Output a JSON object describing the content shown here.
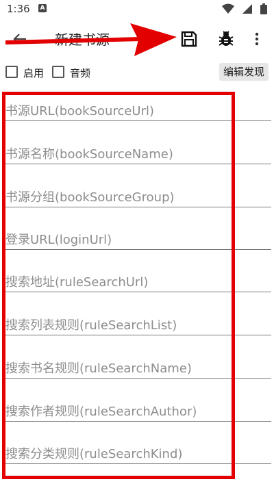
{
  "status_bar": {
    "time": "1:36",
    "notif_letter": "A"
  },
  "toolbar": {
    "title": "新建书源"
  },
  "options": {
    "enable_label": "启用",
    "audio_label": "音频",
    "edit_discover_label": "编辑发现"
  },
  "fields": [
    {
      "placeholder": "书源URL(bookSourceUrl)"
    },
    {
      "placeholder": "书源名称(bookSourceName)"
    },
    {
      "placeholder": "书源分组(bookSourceGroup)"
    },
    {
      "placeholder": "登录URL(loginUrl)"
    },
    {
      "placeholder": "搜索地址(ruleSearchUrl)"
    },
    {
      "placeholder": "搜索列表规则(ruleSearchList)"
    },
    {
      "placeholder": "搜索书名规则(ruleSearchName)"
    },
    {
      "placeholder": "搜索作者规则(ruleSearchAuthor)"
    },
    {
      "placeholder": "搜索分类规则(ruleSearchKind)"
    }
  ],
  "colors": {
    "highlight": "#e20000",
    "placeholder": "#8d8d8d"
  },
  "icons": {
    "back": "arrow-left-icon",
    "save": "save-icon",
    "debug": "bug-icon",
    "more": "more-vertical-icon"
  }
}
